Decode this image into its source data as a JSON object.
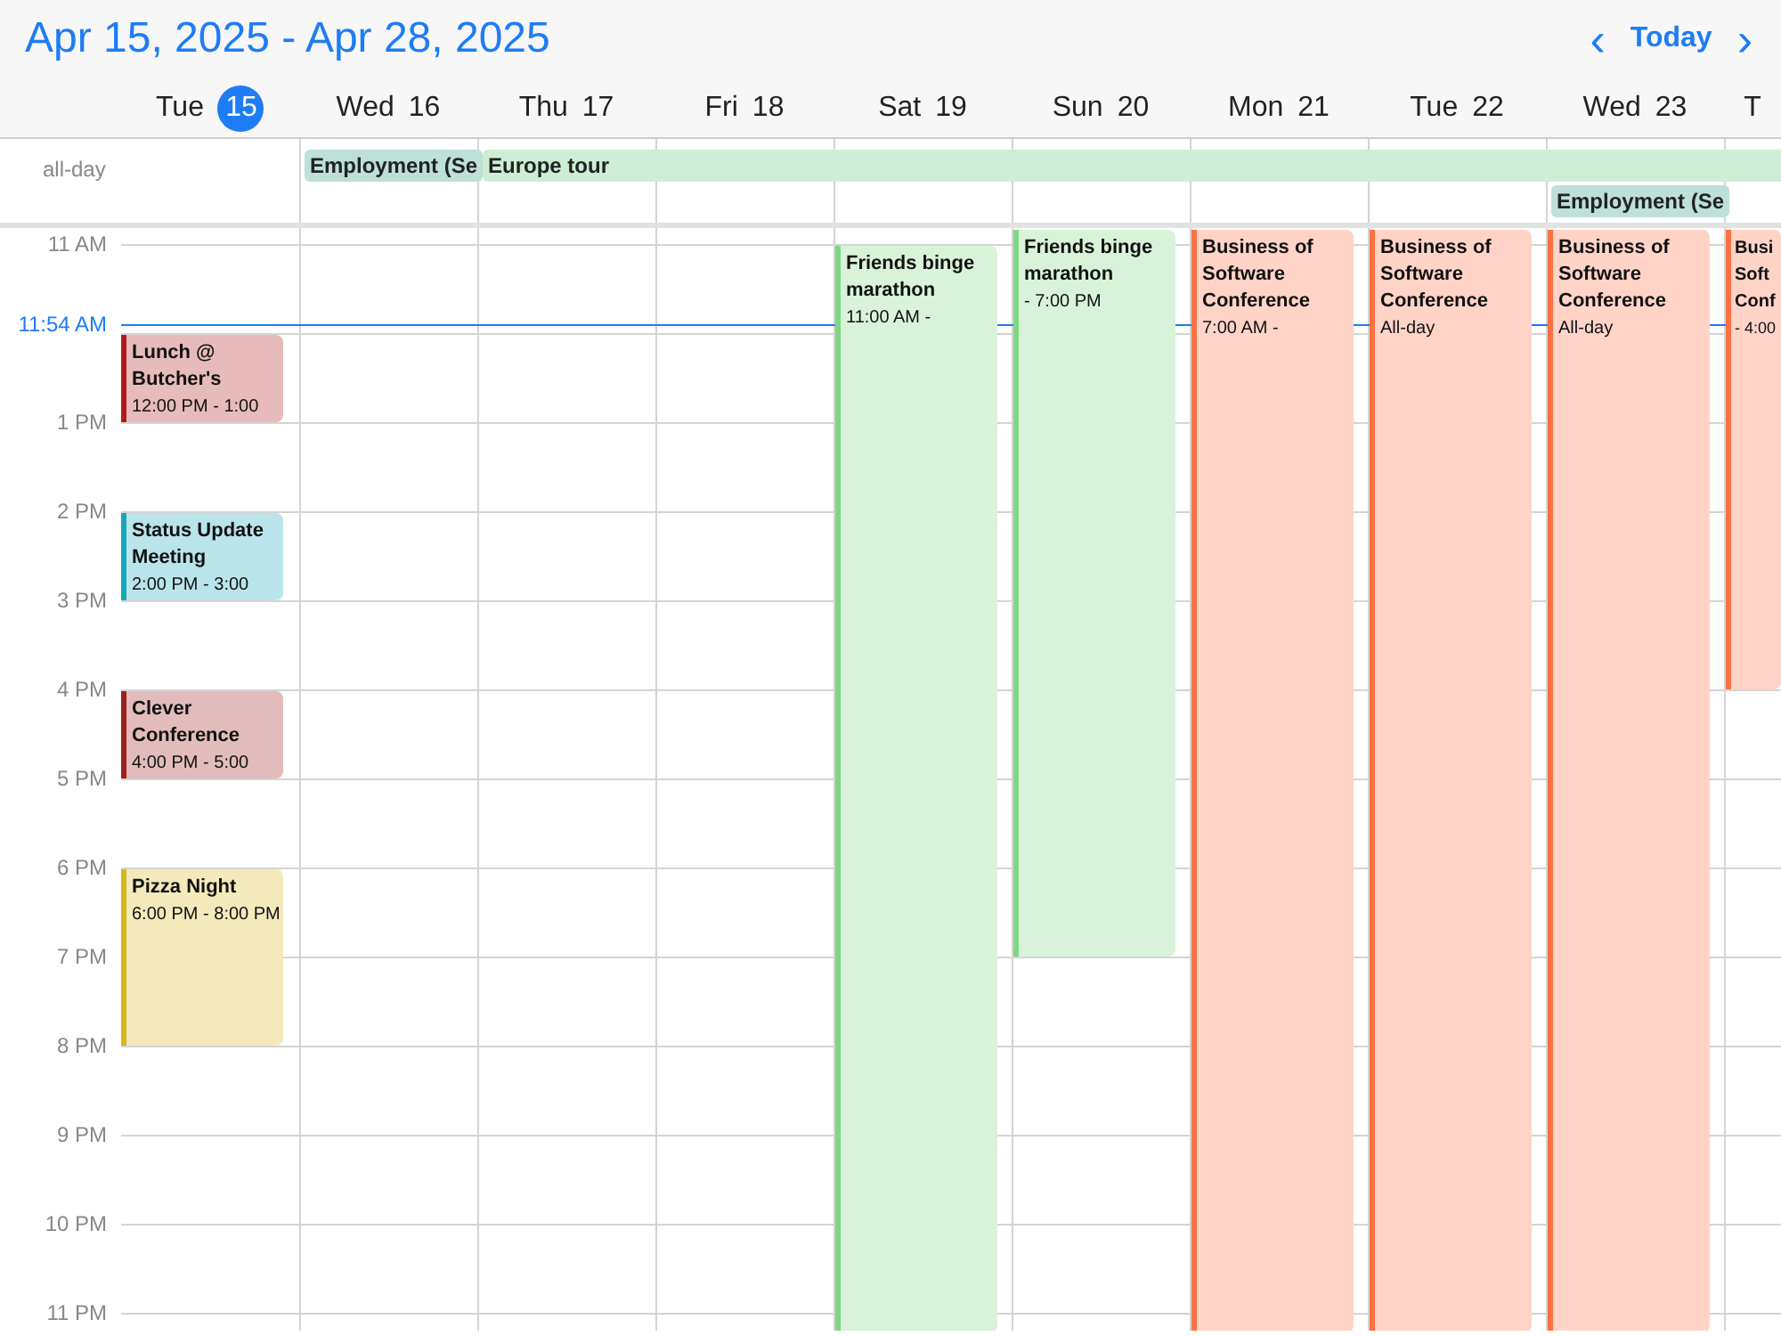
{
  "range_title": "Apr 15, 2025 - Apr 28, 2025",
  "nav": {
    "prev": "‹",
    "today": "Today",
    "next": "›"
  },
  "days": [
    {
      "weekday": "Tue",
      "date": "15",
      "today": true
    },
    {
      "weekday": "Wed",
      "date": "16",
      "today": false
    },
    {
      "weekday": "Thu",
      "date": "17",
      "today": false
    },
    {
      "weekday": "Fri",
      "date": "18",
      "today": false
    },
    {
      "weekday": "Sat",
      "date": "19",
      "today": false
    },
    {
      "weekday": "Sun",
      "date": "20",
      "today": false
    },
    {
      "weekday": "Mon",
      "date": "21",
      "today": false
    },
    {
      "weekday": "Tue",
      "date": "22",
      "today": false
    },
    {
      "weekday": "Wed",
      "date": "23",
      "today": false
    },
    {
      "weekday": "T",
      "today": false
    }
  ],
  "all_day_label": "all-day",
  "all_day_events": [
    {
      "title": "Employment (Se",
      "color": "#bde0d8"
    },
    {
      "title": "Europe tour",
      "color": "#cdeed5"
    },
    {
      "title": "Employment (Se",
      "color": "#bde0d8"
    }
  ],
  "hours": [
    "11 AM",
    "1 PM",
    "2 PM",
    "3 PM",
    "4 PM",
    "5 PM",
    "6 PM",
    "7 PM",
    "8 PM",
    "9 PM",
    "10 PM",
    "11 PM"
  ],
  "now": {
    "label": "11:54 AM"
  },
  "events": [
    {
      "title": "Lunch @ Butcher's",
      "time": "12:00 PM - 1:00",
      "color": "#b01c1c"
    },
    {
      "title": "Status Update Meeting",
      "time": "2:00 PM - 3:00",
      "color": "#17a6b8"
    },
    {
      "title": "Clever Conference",
      "time": "4:00 PM - 5:00",
      "color": "#9e1e1e"
    },
    {
      "title": "Pizza Night",
      "time": "6:00 PM - 8:00 PM",
      "color": "#d8b71c"
    },
    {
      "title": "Friends binge marathon",
      "time": "11:00 AM -",
      "color": "#7fd883"
    },
    {
      "title": "Friends binge marathon",
      "time": "- 7:00 PM",
      "color": "#7fd883"
    },
    {
      "title": "Business of Software Conference",
      "time": "7:00 AM -",
      "color": "#ff7043"
    },
    {
      "title": "Business of Software Conference",
      "time": "All-day",
      "color": "#ff7043"
    },
    {
      "title": "Business of Software Conference",
      "time": "All-day",
      "color": "#ff7043"
    },
    {
      "title": "Busi Soft Conf",
      "time": "- 4:00",
      "color": "#ff7043"
    }
  ]
}
